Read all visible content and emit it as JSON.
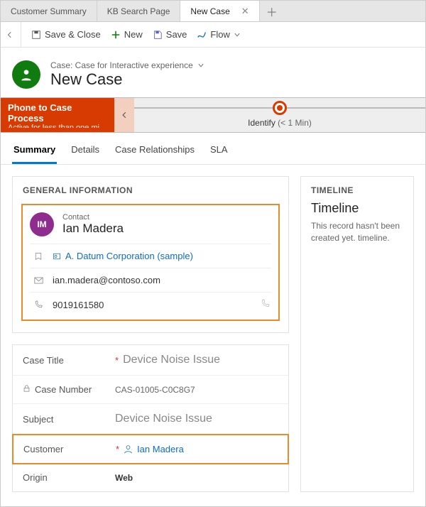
{
  "tabs": {
    "items": [
      "Customer Summary",
      "KB Search Page",
      "New Case"
    ],
    "activeIndex": 2
  },
  "toolbar": {
    "saveClose": "Save & Close",
    "new": "New",
    "save": "Save",
    "flow": "Flow"
  },
  "header": {
    "breadcrumb": "Case: Case for Interactive experience",
    "title": "New Case"
  },
  "process": {
    "name": "Phone to Case Process",
    "sub": "Active for less than one mi...",
    "stageName": "Identify",
    "stageDuration": "(< 1 Min)"
  },
  "subtabs": [
    "Summary",
    "Details",
    "Case Relationships",
    "SLA"
  ],
  "general": {
    "sectionTitle": "GENERAL INFORMATION",
    "contactLabel": "Contact",
    "contactName": "Ian Madera",
    "contactInitials": "IM",
    "account": "A. Datum Corporation (sample)",
    "email": "ian.madera@contoso.com",
    "phone": "9019161580"
  },
  "fields": {
    "caseTitle": {
      "label": "Case Title",
      "value": "Device Noise Issue",
      "required": true
    },
    "caseNumber": {
      "label": "Case Number",
      "value": "CAS-01005-C0C8G7",
      "locked": true
    },
    "subject": {
      "label": "Subject",
      "value": "Device Noise Issue"
    },
    "customer": {
      "label": "Customer",
      "value": "Ian Madera",
      "required": true
    },
    "origin": {
      "label": "Origin",
      "value": "Web"
    }
  },
  "timeline": {
    "sectionTitle": "TIMELINE",
    "heading": "Timeline",
    "message": "This record hasn't been created yet. timeline."
  }
}
